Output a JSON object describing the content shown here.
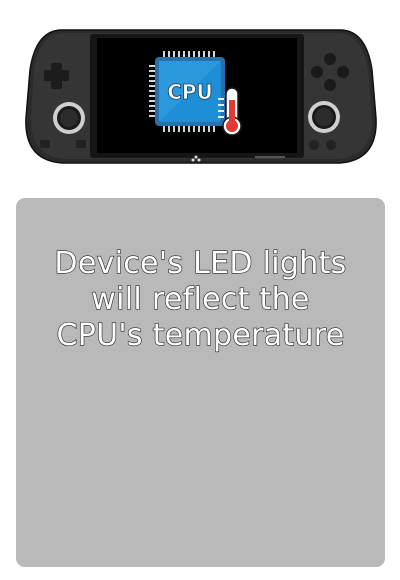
{
  "device": {
    "screen_icon": "cpu-temperature-icon",
    "chip_label": "CPU"
  },
  "info": {
    "lines": [
      "Device's LED lights",
      "will reflect the",
      "CPU's temperature"
    ]
  },
  "colors": {
    "panel_background": "#b9b9b9",
    "chip_blue": "#1e8ed6",
    "device_body": "#2a2a2a",
    "thermometer_red": "#e53935"
  }
}
